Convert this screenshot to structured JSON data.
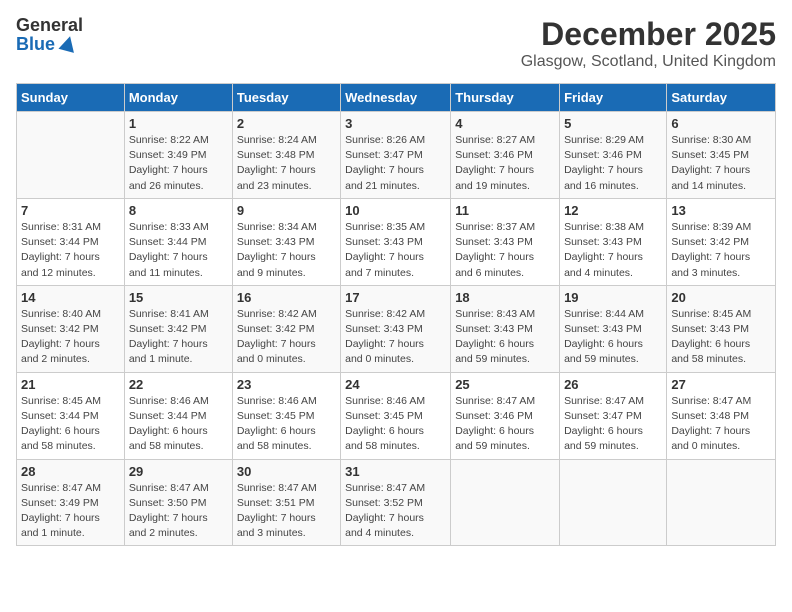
{
  "logo": {
    "general": "General",
    "blue": "Blue"
  },
  "title": "December 2025",
  "subtitle": "Glasgow, Scotland, United Kingdom",
  "days": [
    "Sunday",
    "Monday",
    "Tuesday",
    "Wednesday",
    "Thursday",
    "Friday",
    "Saturday"
  ],
  "weeks": [
    [
      {
        "day": "",
        "info": ""
      },
      {
        "day": "1",
        "info": "Sunrise: 8:22 AM\nSunset: 3:49 PM\nDaylight: 7 hours\nand 26 minutes."
      },
      {
        "day": "2",
        "info": "Sunrise: 8:24 AM\nSunset: 3:48 PM\nDaylight: 7 hours\nand 23 minutes."
      },
      {
        "day": "3",
        "info": "Sunrise: 8:26 AM\nSunset: 3:47 PM\nDaylight: 7 hours\nand 21 minutes."
      },
      {
        "day": "4",
        "info": "Sunrise: 8:27 AM\nSunset: 3:46 PM\nDaylight: 7 hours\nand 19 minutes."
      },
      {
        "day": "5",
        "info": "Sunrise: 8:29 AM\nSunset: 3:46 PM\nDaylight: 7 hours\nand 16 minutes."
      },
      {
        "day": "6",
        "info": "Sunrise: 8:30 AM\nSunset: 3:45 PM\nDaylight: 7 hours\nand 14 minutes."
      }
    ],
    [
      {
        "day": "7",
        "info": "Sunrise: 8:31 AM\nSunset: 3:44 PM\nDaylight: 7 hours\nand 12 minutes."
      },
      {
        "day": "8",
        "info": "Sunrise: 8:33 AM\nSunset: 3:44 PM\nDaylight: 7 hours\nand 11 minutes."
      },
      {
        "day": "9",
        "info": "Sunrise: 8:34 AM\nSunset: 3:43 PM\nDaylight: 7 hours\nand 9 minutes."
      },
      {
        "day": "10",
        "info": "Sunrise: 8:35 AM\nSunset: 3:43 PM\nDaylight: 7 hours\nand 7 minutes."
      },
      {
        "day": "11",
        "info": "Sunrise: 8:37 AM\nSunset: 3:43 PM\nDaylight: 7 hours\nand 6 minutes."
      },
      {
        "day": "12",
        "info": "Sunrise: 8:38 AM\nSunset: 3:43 PM\nDaylight: 7 hours\nand 4 minutes."
      },
      {
        "day": "13",
        "info": "Sunrise: 8:39 AM\nSunset: 3:42 PM\nDaylight: 7 hours\nand 3 minutes."
      }
    ],
    [
      {
        "day": "14",
        "info": "Sunrise: 8:40 AM\nSunset: 3:42 PM\nDaylight: 7 hours\nand 2 minutes."
      },
      {
        "day": "15",
        "info": "Sunrise: 8:41 AM\nSunset: 3:42 PM\nDaylight: 7 hours\nand 1 minute."
      },
      {
        "day": "16",
        "info": "Sunrise: 8:42 AM\nSunset: 3:42 PM\nDaylight: 7 hours\nand 0 minutes."
      },
      {
        "day": "17",
        "info": "Sunrise: 8:42 AM\nSunset: 3:43 PM\nDaylight: 7 hours\nand 0 minutes."
      },
      {
        "day": "18",
        "info": "Sunrise: 8:43 AM\nSunset: 3:43 PM\nDaylight: 6 hours\nand 59 minutes."
      },
      {
        "day": "19",
        "info": "Sunrise: 8:44 AM\nSunset: 3:43 PM\nDaylight: 6 hours\nand 59 minutes."
      },
      {
        "day": "20",
        "info": "Sunrise: 8:45 AM\nSunset: 3:43 PM\nDaylight: 6 hours\nand 58 minutes."
      }
    ],
    [
      {
        "day": "21",
        "info": "Sunrise: 8:45 AM\nSunset: 3:44 PM\nDaylight: 6 hours\nand 58 minutes."
      },
      {
        "day": "22",
        "info": "Sunrise: 8:46 AM\nSunset: 3:44 PM\nDaylight: 6 hours\nand 58 minutes."
      },
      {
        "day": "23",
        "info": "Sunrise: 8:46 AM\nSunset: 3:45 PM\nDaylight: 6 hours\nand 58 minutes."
      },
      {
        "day": "24",
        "info": "Sunrise: 8:46 AM\nSunset: 3:45 PM\nDaylight: 6 hours\nand 58 minutes."
      },
      {
        "day": "25",
        "info": "Sunrise: 8:47 AM\nSunset: 3:46 PM\nDaylight: 6 hours\nand 59 minutes."
      },
      {
        "day": "26",
        "info": "Sunrise: 8:47 AM\nSunset: 3:47 PM\nDaylight: 6 hours\nand 59 minutes."
      },
      {
        "day": "27",
        "info": "Sunrise: 8:47 AM\nSunset: 3:48 PM\nDaylight: 7 hours\nand 0 minutes."
      }
    ],
    [
      {
        "day": "28",
        "info": "Sunrise: 8:47 AM\nSunset: 3:49 PM\nDaylight: 7 hours\nand 1 minute."
      },
      {
        "day": "29",
        "info": "Sunrise: 8:47 AM\nSunset: 3:50 PM\nDaylight: 7 hours\nand 2 minutes."
      },
      {
        "day": "30",
        "info": "Sunrise: 8:47 AM\nSunset: 3:51 PM\nDaylight: 7 hours\nand 3 minutes."
      },
      {
        "day": "31",
        "info": "Sunrise: 8:47 AM\nSunset: 3:52 PM\nDaylight: 7 hours\nand 4 minutes."
      },
      {
        "day": "",
        "info": ""
      },
      {
        "day": "",
        "info": ""
      },
      {
        "day": "",
        "info": ""
      }
    ]
  ]
}
